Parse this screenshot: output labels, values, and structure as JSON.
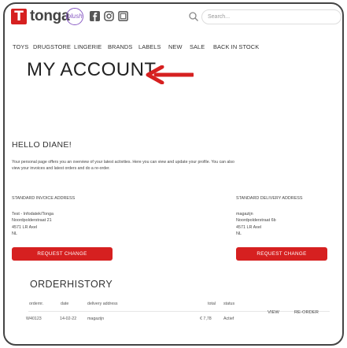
{
  "brand": {
    "logo_letter": "T",
    "name": "tonga",
    "sub_brand": "plush"
  },
  "header": {
    "social_icons": [
      "facebook-icon",
      "instagram-icon",
      "other-social-icon"
    ],
    "search": {
      "placeholder": "Search..."
    }
  },
  "nav": {
    "items": [
      {
        "label": "TOYS"
      },
      {
        "label": "DRUGSTORE"
      },
      {
        "label": "LINGERIE"
      },
      {
        "label": "BRANDS"
      },
      {
        "label": "LABELS"
      },
      {
        "label": "NEW"
      },
      {
        "label": "SALE"
      },
      {
        "label": "BACK IN STOCK"
      }
    ]
  },
  "page": {
    "title": "MY ACCOUNT",
    "greeting": "HELLO DIANE!",
    "intro": "Your personal page offers you an overview of your latest activities. Here you can view and update your profile. You can also view your invoices and latest orders and do a re-order."
  },
  "invoice_address": {
    "heading": "STANDARD INVOICE ADDRESS",
    "lines": [
      "Test - Infodatek/Tonga",
      "Noordpolderstraat 21",
      "4571 LR Axel",
      "NL"
    ],
    "button": "REQUEST CHANGE"
  },
  "delivery_address": {
    "heading": "STANDARD DELIVERY ADDRESS",
    "lines": [
      "magazijn",
      "Noordpolderstraat 6b",
      "4571 LR Axel",
      "NL"
    ],
    "button": "REQUEST CHANGE"
  },
  "orders": {
    "title": "ORDERHISTORY",
    "columns": [
      "ordernr.",
      "date",
      "delivery address",
      "total",
      "status"
    ],
    "rows": [
      {
        "ordernr": "W40123",
        "date": "14-02-22",
        "address": "magazijn",
        "total": "€ 7,78",
        "status": "Actief",
        "view": "VIEW",
        "reorder": "RE-ORDER"
      }
    ]
  },
  "colors": {
    "accent": "#d62020",
    "sub_brand": "#8a5cc4"
  }
}
